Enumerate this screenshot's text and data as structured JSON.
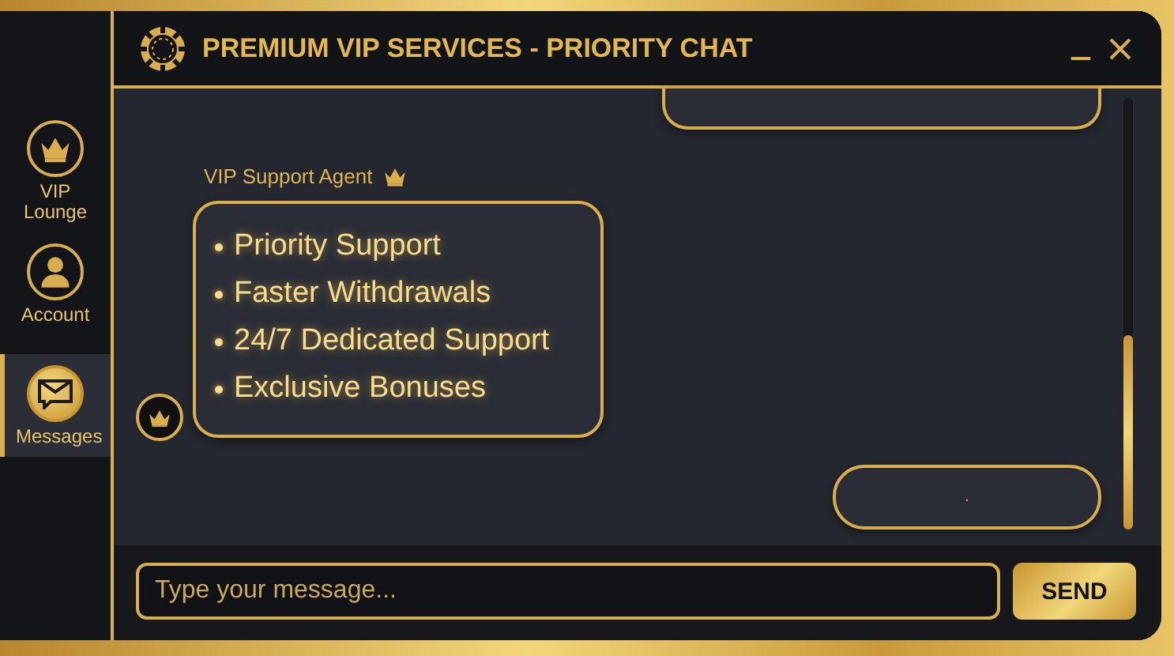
{
  "window": {
    "title": "PREMIUM VIP SERVICES - PRIORITY CHAT"
  },
  "sidebar": {
    "items": [
      {
        "label": "VIP Lounge",
        "selected": false
      },
      {
        "label": "Account",
        "selected": false
      },
      {
        "label": "Messages",
        "selected": true
      }
    ]
  },
  "chat": {
    "messages": [
      {
        "kind": "sent",
        "cut_off": true
      },
      {
        "kind": "received",
        "sender": "VIP Support Agent",
        "bullets": [
          "Priority Support",
          "Faster Withdrawals",
          "24/7 Dedicated Support",
          "Exclusive Bonuses"
        ]
      },
      {
        "kind": "sent",
        "text": "."
      }
    ]
  },
  "composer": {
    "placeholder": "Type your message...",
    "send_button": "SEND"
  }
}
